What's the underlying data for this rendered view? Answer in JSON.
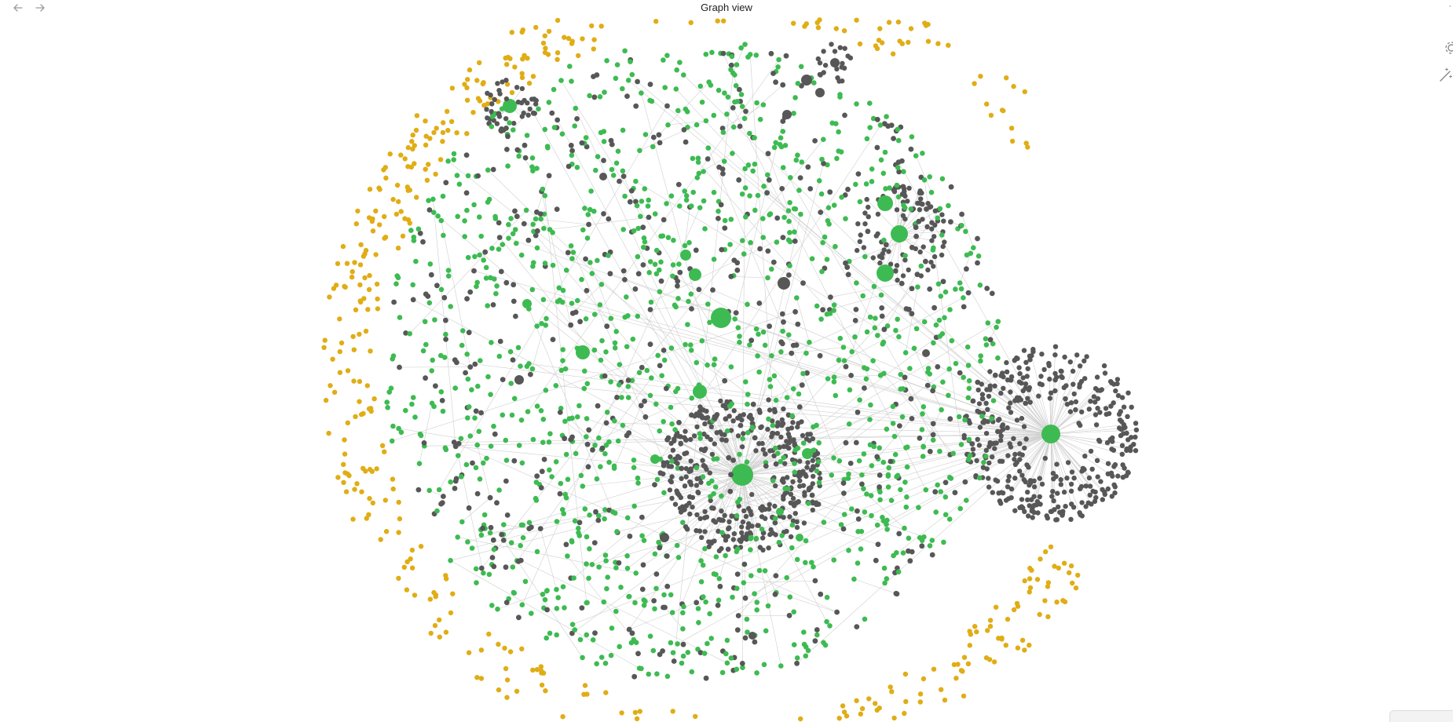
{
  "window": {
    "title": "Graph view"
  },
  "nav": {
    "back_icon": "arrow-left-icon",
    "forward_icon": "arrow-right-icon"
  },
  "toolbar": {
    "settings_icon": "gear-icon",
    "wand_icon": "magic-wand-icon"
  },
  "graph": {
    "colors": {
      "tag_node": "#3dbb52",
      "note_node": "#575757",
      "orphan_node": "#e0ad15",
      "edge": "#cfcfcf",
      "background": "#ffffff"
    }
  }
}
